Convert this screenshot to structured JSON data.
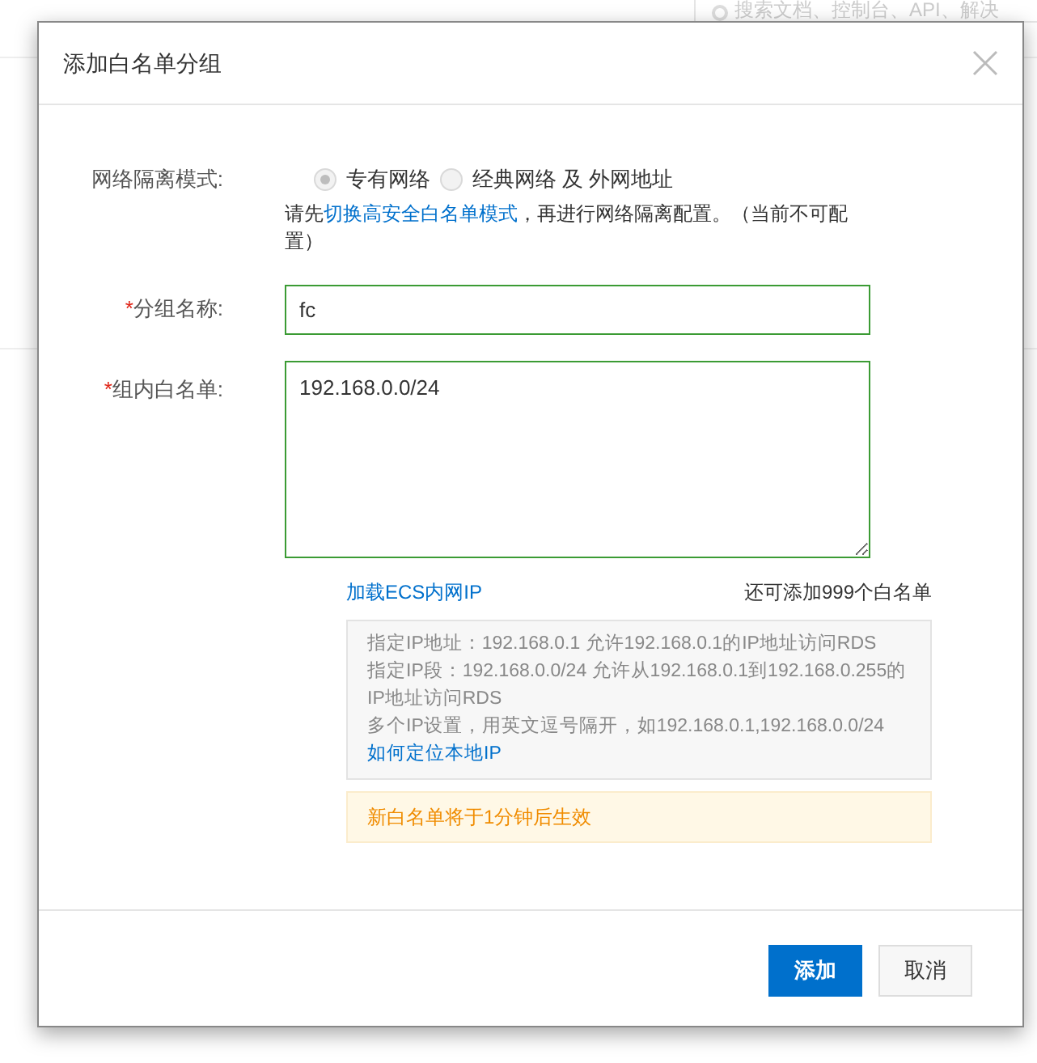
{
  "background": {
    "search": {
      "placeholder": "搜索文档、控制台、API、解决"
    }
  },
  "dialog": {
    "title": "添加白名单分组",
    "network_mode": {
      "label": "网络隔离模式:",
      "disabled": true,
      "options": [
        {
          "label": "专有网络",
          "selected": true
        },
        {
          "label": "经典网络 及 外网地址",
          "selected": false
        }
      ],
      "note_before": "请先",
      "note_link": "切换高安全白名单模式",
      "note_after": "，再进行网络隔离配置。（当前不可配置）"
    },
    "group_name": {
      "label": "分组名称:",
      "required": true,
      "required_mark": "*",
      "value": "fc"
    },
    "whitelist": {
      "label": "组内白名单:",
      "required": true,
      "required_mark": "*",
      "value": "192.168.0.0/24"
    },
    "load_link": "加载ECS内网IP",
    "remaining": "还可添加999个白名单",
    "help_lines": [
      "指定IP地址：192.168.0.1 允许192.168.0.1的IP地址访问RDS",
      "指定IP段：192.168.0.0/24 允许从192.168.0.1到192.168.0.255的IP地址访问RDS",
      "多个IP设置，用英文逗号隔开，如192.168.0.1,192.168.0.0/24"
    ],
    "help_link": "如何定位本地IP",
    "notice": "新白名单将于1分钟后生效",
    "buttons": [
      {
        "label": "添加",
        "kind": "primary"
      },
      {
        "label": "取消",
        "kind": "secondary"
      }
    ]
  }
}
